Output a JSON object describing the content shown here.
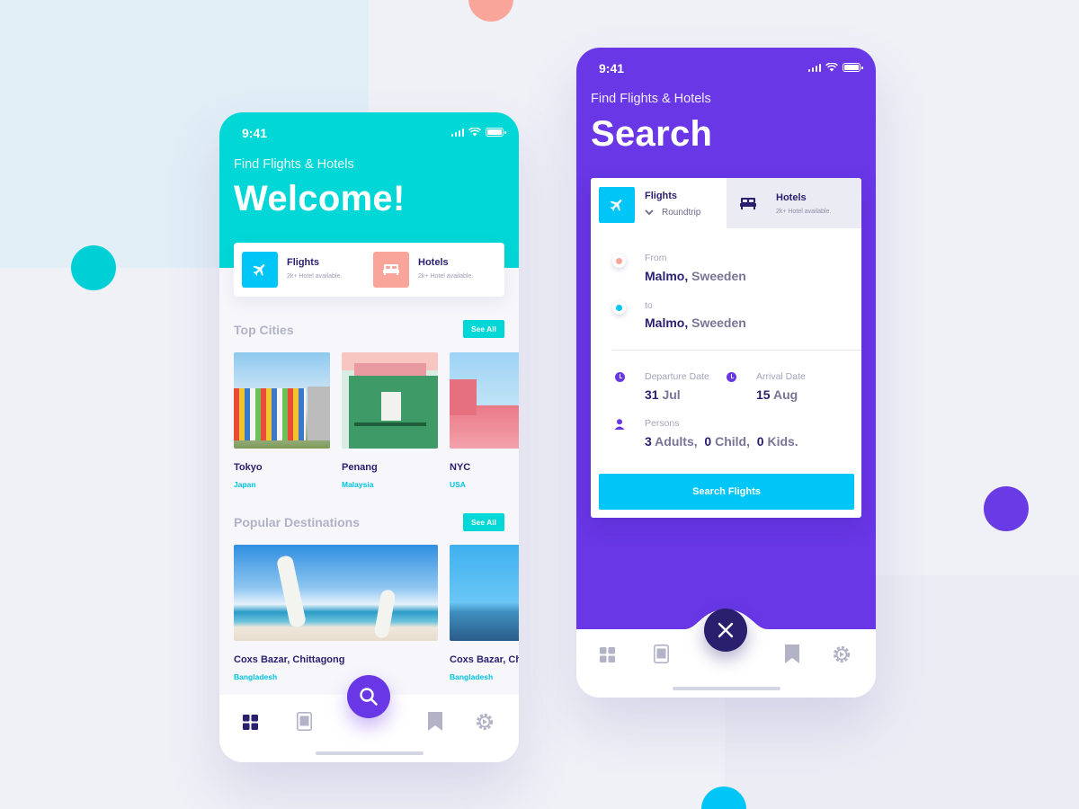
{
  "colors": {
    "teal": "#00d7d6",
    "purple": "#6937e6",
    "cyan": "#00c5f7",
    "navy": "#2a1f6e",
    "coral": "#f9a59a"
  },
  "home": {
    "status_time": "9:41",
    "subtitle": "Find Flights & Hotels",
    "title": "Welcome!",
    "categories": [
      {
        "label": "Flights",
        "sub": "2k+ Hotel available.",
        "icon": "plane-icon"
      },
      {
        "label": "Hotels",
        "sub": "2k+ Hotel available.",
        "icon": "bed-icon"
      }
    ],
    "top_cities": {
      "title": "Top Cities",
      "see_all": "See All",
      "items": [
        {
          "name": "Tokyo",
          "country": "Japan"
        },
        {
          "name": "Penang",
          "country": "Malaysia"
        },
        {
          "name": "NYC",
          "country": "USA"
        }
      ]
    },
    "popular": {
      "title": "Popular Destinations",
      "see_all": "See All",
      "items": [
        {
          "name": "Coxs Bazar, Chittagong",
          "country": "Bangladesh"
        },
        {
          "name": "Coxs Bazar, Chittagong",
          "country": "Bangladesh"
        }
      ]
    },
    "nav": [
      "grid-icon",
      "document-icon",
      "search-icon",
      "bookmark-icon",
      "settings-icon"
    ]
  },
  "search": {
    "status_time": "9:41",
    "subtitle": "Find Flights & Hotels",
    "title": "Search",
    "tabs": {
      "flights": {
        "label": "Flights",
        "trip": "Roundtrip"
      },
      "hotels": {
        "label": "Hotels",
        "sub": "2k+ Hotel available."
      }
    },
    "from": {
      "label": "From",
      "city": "Malmo,",
      "country": "Sweeden"
    },
    "to": {
      "label": "to",
      "city": "Malmo,",
      "country": "Sweeden"
    },
    "departure": {
      "label": "Departure Date",
      "day": "31",
      "month": "Jul"
    },
    "arrival": {
      "label": "Arrival Date",
      "day": "15",
      "month": "Aug"
    },
    "persons": {
      "label": "Persons",
      "adults_n": "3",
      "adults_l": "Adults,",
      "child_n": "0",
      "child_l": "Child,",
      "kids_n": "0",
      "kids_l": "Kids."
    },
    "button": "Search Flights",
    "nav": [
      "grid-icon",
      "document-icon",
      "close-icon",
      "bookmark-icon",
      "settings-icon"
    ]
  }
}
